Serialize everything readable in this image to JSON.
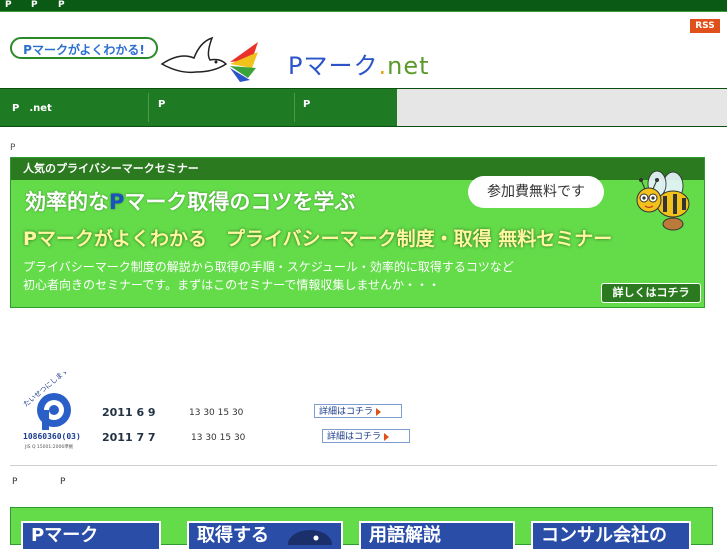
{
  "topbar": {
    "items": [
      "P",
      "P",
      "P"
    ]
  },
  "header": {
    "logo_bubble": "Pマークがよくわかる!",
    "site_name_main": "Pマーク",
    "site_name_dot": ".",
    "site_name_net": "net",
    "rss": "RSS"
  },
  "nav": {
    "items": [
      "P　.net",
      "P",
      "P"
    ]
  },
  "breadcrumb": "P",
  "banner": {
    "head": "人気のプライバシーマークセミナー",
    "title_prefix": "効率的な",
    "title_accent": "P",
    "title_suffix": "マーク取得のコツを学ぶ",
    "subtitle": "Pマークがよくわかる　プライバシーマーク制度・取得 無料セミナー",
    "desc_line1": "プライバシーマーク制度の解説から取得の手順・スケジュール・効率的に取得するコツなど",
    "desc_line2": "初心者向きのセミナーです。まずはこのセミナーで情報収集しませんか・・・",
    "speech": "参加費無料です",
    "details_button": "詳しくはコチラ"
  },
  "pmark_logo": {
    "arc_text": "たいせつにしますプライバシー",
    "number": "10860360(03)",
    "small": "JIS Q 15001:2006準拠"
  },
  "events": [
    {
      "date": "2011 6 9",
      "time": "13 30 15 30",
      "link": "詳細はコチラ"
    },
    {
      "date": "2011 7 7",
      "time": "13 30 15 30",
      "link": "詳細はコチラ"
    }
  ],
  "sections": {
    "label_a": "P",
    "label_b": "P"
  },
  "cards": [
    {
      "label": "Pマーク"
    },
    {
      "label": "取得する"
    },
    {
      "label": "用語解説"
    },
    {
      "label": "コンサル会社の"
    }
  ],
  "colors": {
    "topbar": "#0a5a16",
    "nav": "#1f7a24",
    "banner": "#64dc4a",
    "brand_blue": "#2b54c8",
    "rss": "#e0501a"
  }
}
